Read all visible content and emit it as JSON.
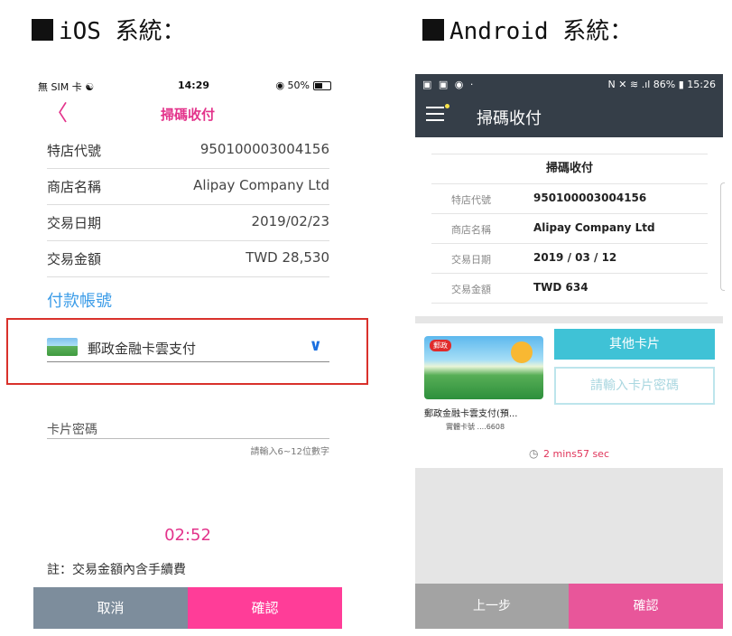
{
  "ios": {
    "section_title": "iOS 系統：",
    "status": {
      "left": "無 SIM 卡 ☯",
      "time": "14:29",
      "battery": "◉ 50%"
    },
    "nav": {
      "back": "〈",
      "title": "掃碼收付"
    },
    "rows": [
      {
        "label": "特店代號",
        "value": "950100003004156"
      },
      {
        "label": "商店名稱",
        "value": "Alipay Company Ltd"
      },
      {
        "label": "交易日期",
        "value": "2019/02/23"
      },
      {
        "label": "交易金額",
        "value": "TWD 28,530"
      }
    ],
    "pay_account_title": "付款帳號",
    "selected_card": "郵政金融卡雲支付",
    "password": {
      "label": "卡片密碼",
      "hint": "請輸入6~12位數字"
    },
    "timer": "02:52",
    "note": "註：交易金額內含手續費",
    "buttons": {
      "cancel": "取消",
      "confirm": "確認"
    }
  },
  "android": {
    "section_title": "Android 系統：",
    "status": {
      "left": "▣ ▣ ◉ ·",
      "right": "N ✕ ≋ .ıl 86% ▮ 15:26"
    },
    "app_title": "掃碼收付",
    "info_header": "掃碼收付",
    "rows": [
      {
        "label": "特店代號",
        "value": "950100003004156"
      },
      {
        "label": "商店名稱",
        "value": "Alipay Company Ltd"
      },
      {
        "label": "交易日期",
        "value": "2019 / 03 / 12"
      },
      {
        "label": "交易金額",
        "value": "TWD 634"
      }
    ],
    "card_name": "郵政金融卡雲支付(預...",
    "card_number": "實體卡號 ....6608",
    "card_badge": "郵政",
    "other_cards_button": "其他卡片",
    "password_placeholder": "請輸入卡片密碼",
    "timer": "2 mins57 sec",
    "buttons": {
      "previous": "上一步",
      "confirm": "確認"
    }
  },
  "colors": {
    "ios_accent": "#e3338b",
    "ios_link": "#3b9ce8",
    "ios_highlight_border": "#d9312b",
    "android_bar": "#353e48",
    "android_teal": "#3fc2d6",
    "android_pink": "#e8569a"
  }
}
